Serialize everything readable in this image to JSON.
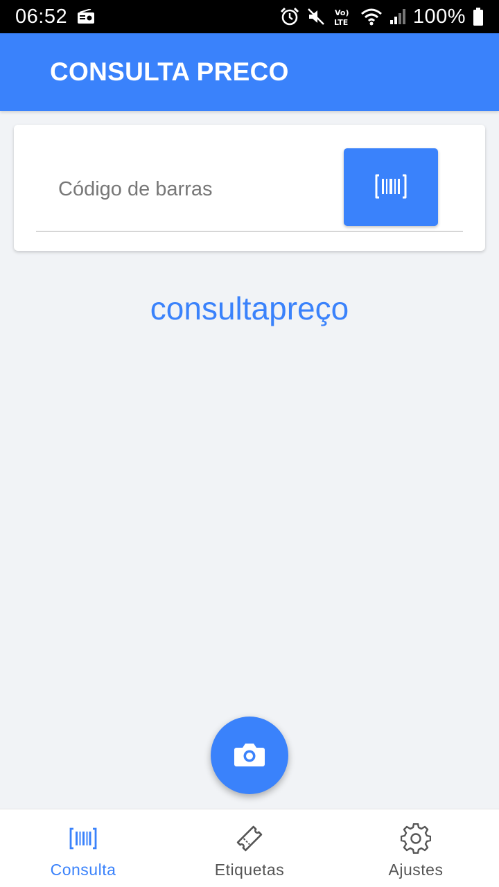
{
  "status_bar": {
    "time": "06:52",
    "battery": "100%",
    "icons": [
      "radio-icon",
      "alarm-icon",
      "mute-icon",
      "volte-icon",
      "wifi-icon",
      "signal-icon",
      "battery-icon"
    ]
  },
  "app_bar": {
    "title": "CONSULTA PRECO"
  },
  "search": {
    "placeholder": "Código de barras",
    "value": "",
    "scan_button_icon": "barcode-icon"
  },
  "brand": {
    "text": "consultapreço"
  },
  "fab": {
    "icon": "camera-icon"
  },
  "bottom_nav": {
    "items": [
      {
        "label": "Consulta",
        "icon": "barcode-icon",
        "active": true
      },
      {
        "label": "Etiquetas",
        "icon": "ticket-icon",
        "active": false
      },
      {
        "label": "Ajustes",
        "icon": "gear-icon",
        "active": false
      }
    ]
  },
  "colors": {
    "primary": "#3a82fb",
    "background": "#f1f3f6",
    "nav_inactive": "#555555"
  }
}
